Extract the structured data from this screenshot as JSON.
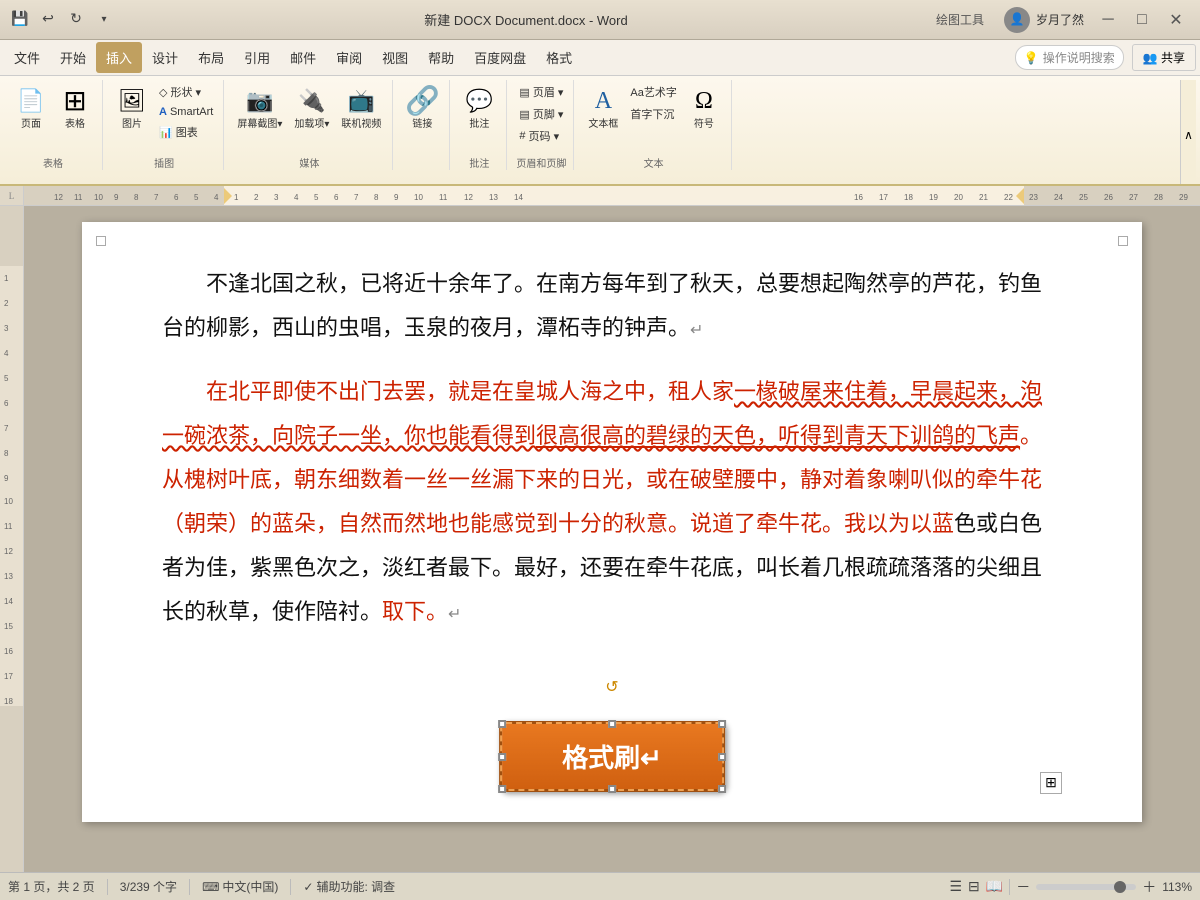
{
  "titleBar": {
    "title": "新建 DOCX Document.docx - Word",
    "drawingTools": "绘图工具",
    "username": "岁月了然",
    "windowControls": {
      "minimize": "─",
      "restore": "□",
      "close": "✕"
    }
  },
  "menuBar": {
    "items": [
      "文件",
      "开始",
      "插入",
      "设计",
      "布局",
      "引用",
      "邮件",
      "审阅",
      "视图",
      "帮助",
      "百度网盘",
      "格式"
    ],
    "activeItem": "插入",
    "searchPlaceholder": "操作说明搜索",
    "shareLabel": "共享"
  },
  "ribbon": {
    "groups": [
      {
        "name": "表格",
        "label": "表格",
        "items": [
          {
            "icon": "📄",
            "label": "页面"
          },
          {
            "icon": "⊞",
            "label": "表格"
          }
        ]
      },
      {
        "name": "图片",
        "label": "插图",
        "items": [
          {
            "icon": "🖼",
            "label": "图片"
          },
          {
            "icon": "◇",
            "label": "形状▾"
          },
          {
            "icon": "A",
            "label": "SmartArt"
          },
          {
            "icon": "📊",
            "label": "图表"
          }
        ]
      },
      {
        "name": "屏幕截图",
        "label": "媒体",
        "items": [
          {
            "icon": "📷",
            "label": "屏幕截图▾"
          },
          {
            "icon": "🎬",
            "label": "加载项▾"
          },
          {
            "icon": "📺",
            "label": "联机视频"
          }
        ]
      },
      {
        "name": "链接",
        "label": "",
        "items": [
          {
            "icon": "🔗",
            "label": "链接"
          }
        ]
      },
      {
        "name": "批注",
        "label": "批注",
        "items": [
          {
            "icon": "💬",
            "label": "批注"
          }
        ]
      },
      {
        "name": "页眉页脚",
        "label": "页眉和页脚",
        "items": [
          {
            "icon": "≡",
            "label": "页眉▾"
          },
          {
            "icon": "≡",
            "label": "页脚▾"
          },
          {
            "icon": "#",
            "label": "页码▾"
          }
        ]
      },
      {
        "name": "文本",
        "label": "文本",
        "items": [
          {
            "icon": "A",
            "label": "文本框"
          },
          {
            "icon": "Ω",
            "label": "符号"
          }
        ]
      }
    ]
  },
  "document": {
    "paragraphs": [
      {
        "id": "p1",
        "text": "不逢北国之秋，已将近十余年了。在南方每年到了秋天，总要想起陶然亭的芦花，钓鱼台的柳影，西山的虫唱，玉泉的夜月，潭柘寺的钟声。",
        "style": "normal",
        "hasReturn": true
      },
      {
        "id": "p2",
        "text": "在北平即使不出门去罢，就是在皇城人海之中，租人家一椽破屋来住着，早晨起来，泡一碗浓茶，向院子一坐，你也能看得到很高很高的碧绿的天色，听得到青天下训鸽的飞声。从槐树叶底，朝东细数着一丝一丝漏下来的日光，或在破壁腰中，静对着象喇叭似的牵牛花（朝荣）的蓝朵，自然而然地也能感觉到十分的秋意。说道了牵牛花。我以为以蓝色或白色者为佳，紫黑色次之，淡红者最下。最好，还要在牵牛花底，叫长着几根疏疏落落的尖细且长的秋草，使作陪衬。取下。",
        "style": "red",
        "hasReturn": true
      }
    ],
    "formatBrush": {
      "label": "格式刷↵",
      "visible": true
    }
  },
  "statusBar": {
    "page": "第 1 页，共 2 页",
    "wordCount": "3/239 个字",
    "language": "中文(中国)",
    "accessibility": "辅助功能: 调查",
    "zoom": "113%",
    "zoomPercent": 113
  },
  "icons": {
    "search": "🔍",
    "share": "👥",
    "save": "💾",
    "undo": "↩",
    "redo": "↺",
    "lightbulb": "💡"
  }
}
